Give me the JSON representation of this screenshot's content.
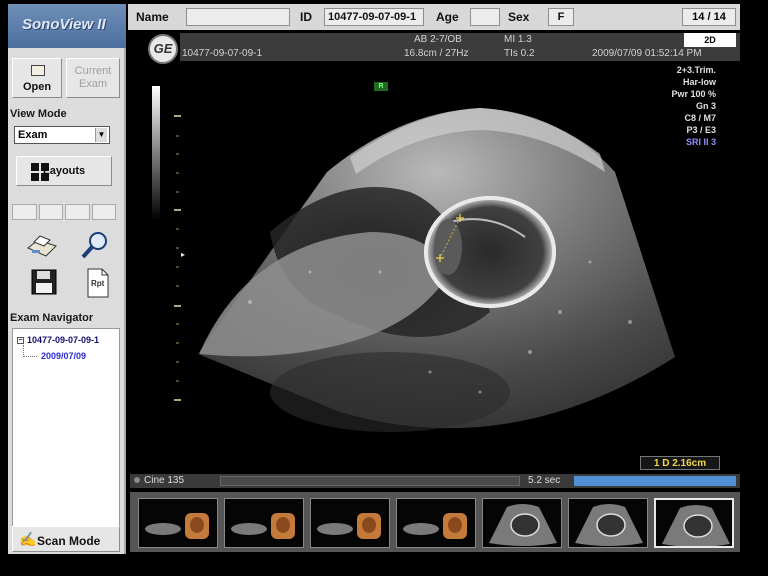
{
  "app": {
    "title": "SonoView II"
  },
  "toolbar": {
    "open_label": "Open",
    "current_exam_label_1": "Current",
    "current_exam_label_2": "Exam",
    "view_mode_label": "View Mode",
    "view_mode_value": "Exam",
    "layouts_label": "Layouts",
    "exam_navigator_label": "Exam Navigator",
    "scan_mode_label": "Scan Mode"
  },
  "icons": [
    "folder-icon",
    "print-icon",
    "zoom-icon",
    "save-icon",
    "report-icon",
    "layouts-icon",
    "scan-mode-icon"
  ],
  "report_icon_text": "Rpt",
  "exam_navigator": {
    "root": "10477-09-07-09-1",
    "child": "2009/07/09"
  },
  "patient": {
    "name_label": "Name",
    "name_value": "",
    "id_label": "ID",
    "id_value": "10477-09-07-09-1",
    "age_label": "Age",
    "age_value": "",
    "sex_label": "Sex",
    "sex_value": "F",
    "page_counter": "14 / 14"
  },
  "image_header": {
    "logo": "GE",
    "probe": "AB 2-7/OB",
    "depth_freq": "16.8cm / 27Hz",
    "mi": "MI  1.3",
    "tis": "TIs  0.2",
    "image_id": "10477-09-07-09-1",
    "datetime": "2009/07/09  01:52:14 PM",
    "mode_badge": "2D"
  },
  "params": [
    "2+3.Trim.",
    "Har-low",
    "Pwr 100 %",
    "Gn  3",
    "C8 / M7",
    "P3 / E3",
    "SRI II 3"
  ],
  "measurement": {
    "readout": "1  D 2.16cm"
  },
  "orientation_marker": "R",
  "cine": {
    "label": "Cine 135",
    "time": "5.2 sec",
    "progress": 1.0
  },
  "thumbnails": {
    "count": 7,
    "selected_index": 6
  },
  "colors": {
    "panel_bg": "#dcdcdc",
    "accent_blue": "#4f8fd6",
    "measure_yellow": "#f2d74a"
  }
}
